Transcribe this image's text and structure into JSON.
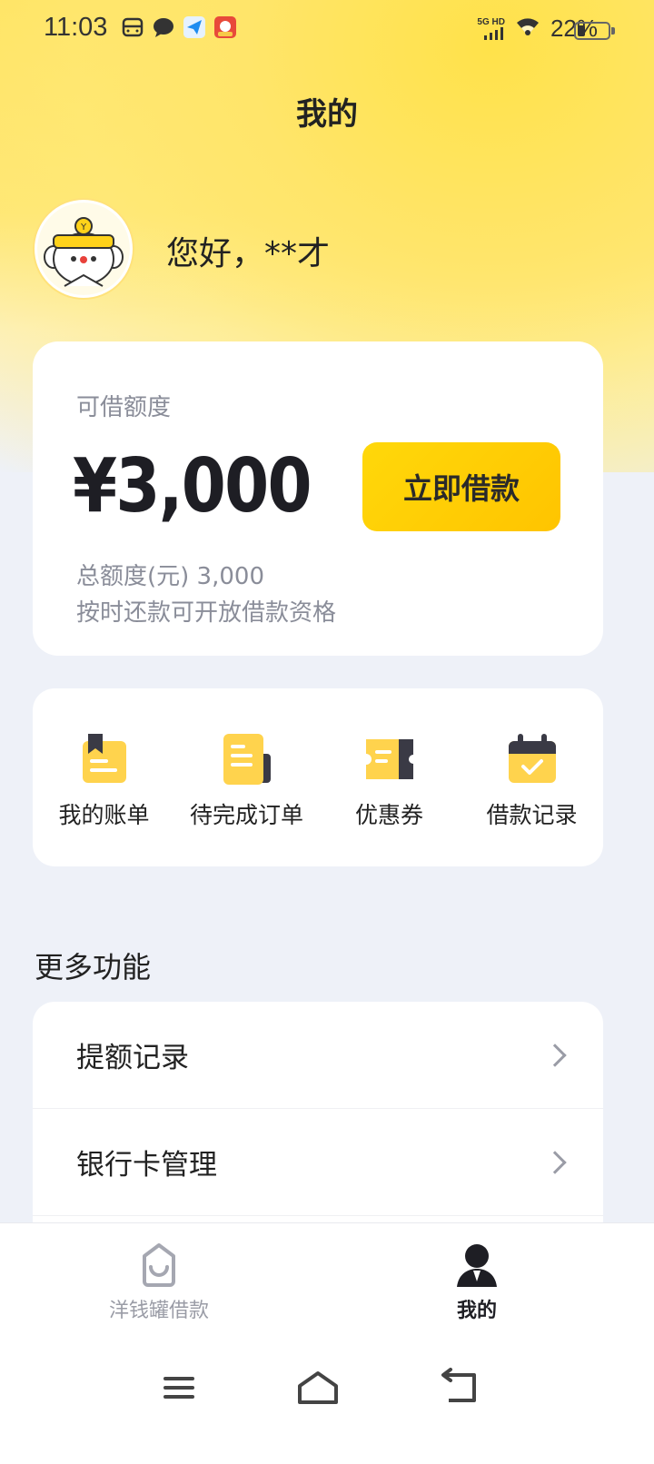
{
  "status_bar": {
    "time": "11:03",
    "network": "5G HD",
    "battery": "22%"
  },
  "header": {
    "title": "我的"
  },
  "profile": {
    "greeting": "您好，**才"
  },
  "credit": {
    "label": "可借额度",
    "amount": "¥3,000",
    "borrow_button": "立即借款",
    "total": "总额度(元) 3,000",
    "hint": "按时还款可开放借款资格"
  },
  "quick_actions": [
    {
      "label": "我的账单",
      "icon": "bill-icon"
    },
    {
      "label": "待完成订单",
      "icon": "order-icon"
    },
    {
      "label": "优惠券",
      "icon": "coupon-icon"
    },
    {
      "label": "借款记录",
      "icon": "calendar-check-icon"
    }
  ],
  "more": {
    "title": "更多功能",
    "items": [
      {
        "label": "提额记录"
      },
      {
        "label": "银行卡管理"
      }
    ]
  },
  "bottom_nav": {
    "tabs": [
      {
        "label": "洋钱罐借款",
        "active": false
      },
      {
        "label": "我的",
        "active": true
      }
    ]
  },
  "colors": {
    "accent": "#FFCC00",
    "background": "#EEF1F8"
  }
}
